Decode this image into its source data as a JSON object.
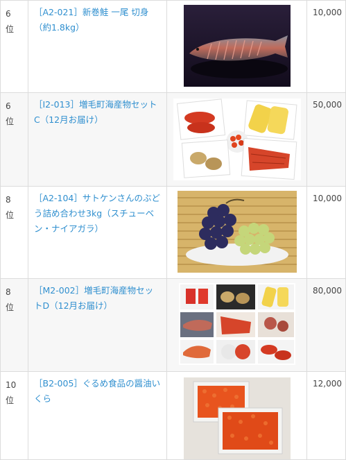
{
  "rows": [
    {
      "rank": "6",
      "rank_suffix": "位",
      "name": "［A2-021］新巻鮭 一尾 切身（約1.8kg）",
      "price": "10,000",
      "image_icon": "salmon-image"
    },
    {
      "rank": "6",
      "rank_suffix": "位",
      "name": "［I2-013］増毛町海産物セットC（12月お届け）",
      "price": "50,000",
      "image_icon": "seafood-set-c-image"
    },
    {
      "rank": "8",
      "rank_suffix": "位",
      "name": "［A2-104］サトケンさんのぶどう詰め合わせ3kg（スチューベン・ナイアガラ）",
      "price": "10,000",
      "image_icon": "grapes-image"
    },
    {
      "rank": "8",
      "rank_suffix": "位",
      "name": "［M2-002］増毛町海産物セットD（12月お届け）",
      "price": "80,000",
      "image_icon": "seafood-set-d-image"
    },
    {
      "rank": "10",
      "rank_suffix": "位",
      "name": "［B2-005］ぐるめ食品の醤油いくら",
      "price": "12,000",
      "image_icon": "ikura-image"
    }
  ]
}
